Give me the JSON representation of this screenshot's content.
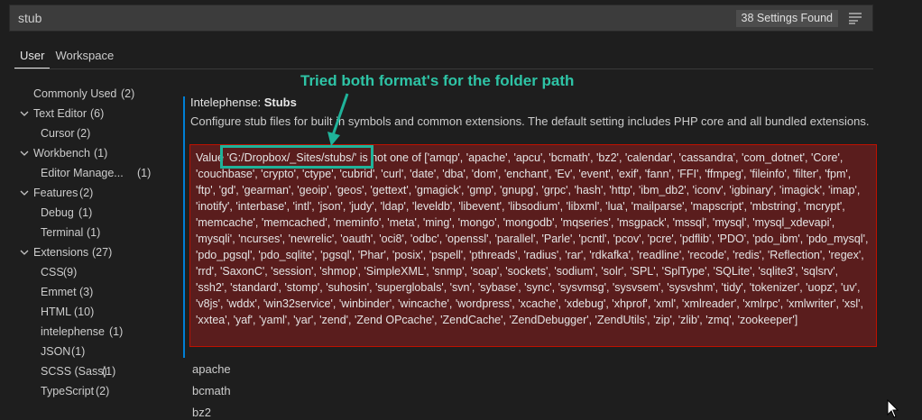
{
  "search": {
    "value": "stub",
    "results_label": "38 Settings Found"
  },
  "tabs": [
    {
      "label": "User"
    },
    {
      "label": "Workspace"
    }
  ],
  "toc": [
    {
      "label": "Commonly Used",
      "count": "(2)",
      "chevron": false,
      "indent": 0
    },
    {
      "label": "Text Editor",
      "count": "(6)",
      "chevron": true,
      "indent": 0
    },
    {
      "label": "Cursor",
      "count": "(2)",
      "chevron": false,
      "indent": 1
    },
    {
      "label": "Workbench",
      "count": "(1)",
      "chevron": true,
      "indent": 0
    },
    {
      "label": "Editor Manage...",
      "count": "(1)",
      "chevron": false,
      "indent": 1
    },
    {
      "label": "Features",
      "count": "(2)",
      "chevron": true,
      "indent": 0
    },
    {
      "label": "Debug",
      "count": "(1)",
      "chevron": false,
      "indent": 1
    },
    {
      "label": "Terminal",
      "count": "(1)",
      "chevron": false,
      "indent": 1
    },
    {
      "label": "Extensions",
      "count": "(27)",
      "chevron": true,
      "indent": 0
    },
    {
      "label": "CSS",
      "count": "(9)",
      "chevron": false,
      "indent": 1
    },
    {
      "label": "Emmet",
      "count": "(3)",
      "chevron": false,
      "indent": 1
    },
    {
      "label": "HTML",
      "count": "(10)",
      "chevron": false,
      "indent": 1
    },
    {
      "label": "intelephense",
      "count": "(1)",
      "chevron": false,
      "indent": 1
    },
    {
      "label": "JSON",
      "count": "(1)",
      "chevron": false,
      "indent": 1
    },
    {
      "label": "SCSS (Sass)",
      "count": "(1)",
      "chevron": false,
      "indent": 1
    },
    {
      "label": "TypeScript",
      "count": "(2)",
      "chevron": false,
      "indent": 1
    }
  ],
  "setting": {
    "category": "Intelephense: ",
    "name": "Stubs",
    "description": "Configure stub files for built in symbols and common extensions. The default setting includes PHP core and all bundled extensions.",
    "error": "Value 'G:/Dropbox/_Sites/stubs/' is not one of ['amqp', 'apache', 'apcu', 'bcmath', 'bz2', 'calendar', 'cassandra', 'com_dotnet', 'Core', 'couchbase', 'crypto', 'ctype', 'cubrid', 'curl', 'date', 'dba', 'dom', 'enchant', 'Ev', 'event', 'exif', 'fann', 'FFI', 'ffmpeg', 'fileinfo', 'filter', 'fpm', 'ftp', 'gd', 'gearman', 'geoip', 'geos', 'gettext', 'gmagick', 'gmp', 'gnupg', 'grpc', 'hash', 'http', 'ibm_db2', 'iconv', 'igbinary', 'imagick', 'imap', 'inotify', 'interbase', 'intl', 'json', 'judy', 'ldap', 'leveldb', 'libevent', 'libsodium', 'libxml', 'lua', 'mailparse', 'mapscript', 'mbstring', 'mcrypt', 'memcache', 'memcached', 'meminfo', 'meta', 'ming', 'mongo', 'mongodb', 'mqseries', 'msgpack', 'mssql', 'mysql', 'mysql_xdevapi', 'mysqli', 'ncurses', 'newrelic', 'oauth', 'oci8', 'odbc', 'openssl', 'parallel', 'Parle', 'pcntl', 'pcov', 'pcre', 'pdflib', 'PDO', 'pdo_ibm', 'pdo_mysql', 'pdo_pgsql', 'pdo_sqlite', 'pgsql', 'Phar', 'posix', 'pspell', 'pthreads', 'radius', 'rar', 'rdkafka', 'readline', 'recode', 'redis', 'Reflection', 'regex', 'rrd', 'SaxonC', 'session', 'shmop', 'SimpleXML', 'snmp', 'soap', 'sockets', 'sodium', 'solr', 'SPL', 'SplType', 'SQLite', 'sqlite3', 'sqlsrv', 'ssh2', 'standard', 'stomp', 'suhosin', 'superglobals', 'svn', 'sybase', 'sync', 'sysvmsg', 'sysvsem', 'sysvshm', 'tidy', 'tokenizer', 'uopz', 'uv', 'v8js', 'wddx', 'win32service', 'winbinder', 'wincache', 'wordpress', 'xcache', 'xdebug', 'xhprof', 'xml', 'xmlreader', 'xmlrpc', 'xmlwriter', 'xsl', 'xxtea', 'yaf', 'yaml', 'yar', 'zend', 'Zend OPcache', 'ZendCache', 'ZendDebugger', 'ZendUtils', 'zip', 'zlib', 'zmq', 'zookeeper']",
    "list": [
      "apache",
      "bcmath",
      "bz2"
    ]
  },
  "annotation": {
    "text": "Tried both format's for the folder path",
    "color": "#2ec4a6"
  },
  "colors": {
    "background": "#1e1e1e",
    "error_bg": "#5a1d1d",
    "error_border": "#be1100",
    "focus_bar": "#007fd4"
  }
}
